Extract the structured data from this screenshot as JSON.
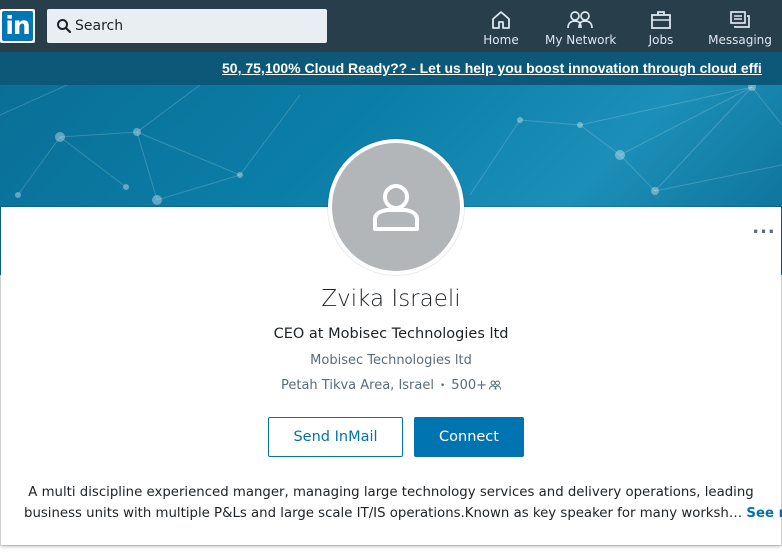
{
  "logo": {
    "text": "in"
  },
  "search": {
    "placeholder": "Search"
  },
  "nav": {
    "home": "Home",
    "network": "My Network",
    "jobs": "Jobs",
    "messaging": "Messaging"
  },
  "promo": {
    "text": "50, 75,100% Cloud Ready?? - Let us help you boost innovation through cloud effi"
  },
  "profile": {
    "name": "Zvika Israeli",
    "headline": "CEO at Mobisec Technologies ltd",
    "company": "Mobisec Technologies ltd",
    "location": "Petah Tikva Area, Israel",
    "separator": "•",
    "connections": "500+"
  },
  "actions": {
    "inmail": "Send InMail",
    "connect": "Connect",
    "overflow": "..."
  },
  "summary": {
    "line1": "A multi discipline experienced manger, managing large technology services and delivery operations, leading",
    "line2": "business units with multiple P&Ls and large scale IT/IS operations.Known as key speaker for many worksh…",
    "see_more": "See more"
  },
  "colors": {
    "nav_bg": "#283e4a",
    "brand": "#0077b5",
    "accent": "#0073b1",
    "promo_bg": "#0d5878"
  }
}
